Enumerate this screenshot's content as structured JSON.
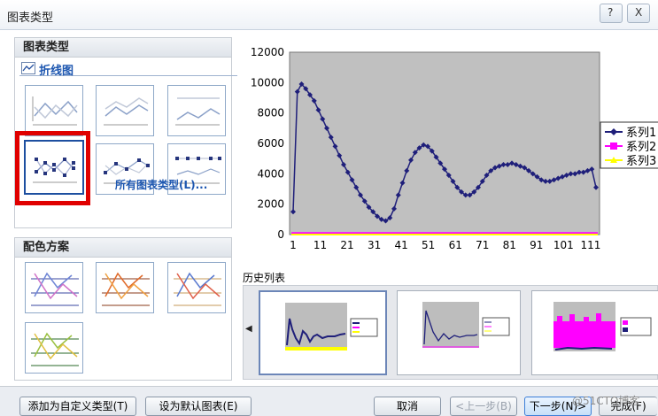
{
  "window": {
    "title": "图表类型",
    "help_label": "?",
    "close_label": "X"
  },
  "chart_type_panel": {
    "heading": "图表类型",
    "subtype_label": "折线图",
    "all_types_link": "所有图表类型(L)...",
    "selected_index": 3
  },
  "color_panel": {
    "heading": "配色方案"
  },
  "history": {
    "label": "历史列表"
  },
  "chart_data": {
    "type": "line",
    "x_ticks": [
      1,
      11,
      21,
      31,
      41,
      51,
      61,
      71,
      81,
      91,
      101,
      111
    ],
    "ylim": [
      0,
      12000
    ],
    "y_ticks": [
      "12000",
      "10000",
      "8000",
      "6000",
      "4000",
      "2000",
      "0"
    ],
    "grid": false,
    "legend": "right",
    "series": [
      {
        "name": "系列1",
        "color": "#1f1f7a",
        "marker": "diamond",
        "values": [
          1500,
          9400,
          9900,
          9600,
          9200,
          8800,
          8200,
          7600,
          7000,
          6400,
          5800,
          5200,
          4600,
          4100,
          3600,
          3100,
          2600,
          2200,
          1800,
          1500,
          1200,
          1000,
          900,
          1100,
          1700,
          2600,
          3400,
          4200,
          4900,
          5400,
          5700,
          5900,
          5800,
          5500,
          5100,
          4700,
          4300,
          3900,
          3500,
          3100,
          2800,
          2600,
          2600,
          2800,
          3100,
          3500,
          3900,
          4200,
          4400,
          4500,
          4600,
          4600,
          4700,
          4600,
          4500,
          4400,
          4200,
          4000,
          3800,
          3600,
          3500,
          3500,
          3600,
          3700,
          3800,
          3900,
          4000,
          4000,
          4100,
          4100,
          4200,
          4300,
          3100
        ]
      },
      {
        "name": "系列2",
        "color": "#ff00ff",
        "marker": "square",
        "values": [
          100,
          100,
          100,
          100,
          100,
          100,
          100,
          100,
          100,
          100,
          100,
          100
        ]
      },
      {
        "name": "系列3",
        "color": "#ffff00",
        "marker": "triangle",
        "values": [
          0,
          0,
          0,
          0,
          0,
          0,
          0,
          0,
          0,
          0,
          0,
          0
        ]
      }
    ]
  },
  "buttons": {
    "add_custom": "添加为自定义类型(T)",
    "set_default": "设为默认图表(E)",
    "cancel": "取消",
    "prev": "<上一步(B)",
    "next": "下一步(N)>",
    "finish": "完成(F)"
  },
  "watermark": "@51CTO博客"
}
